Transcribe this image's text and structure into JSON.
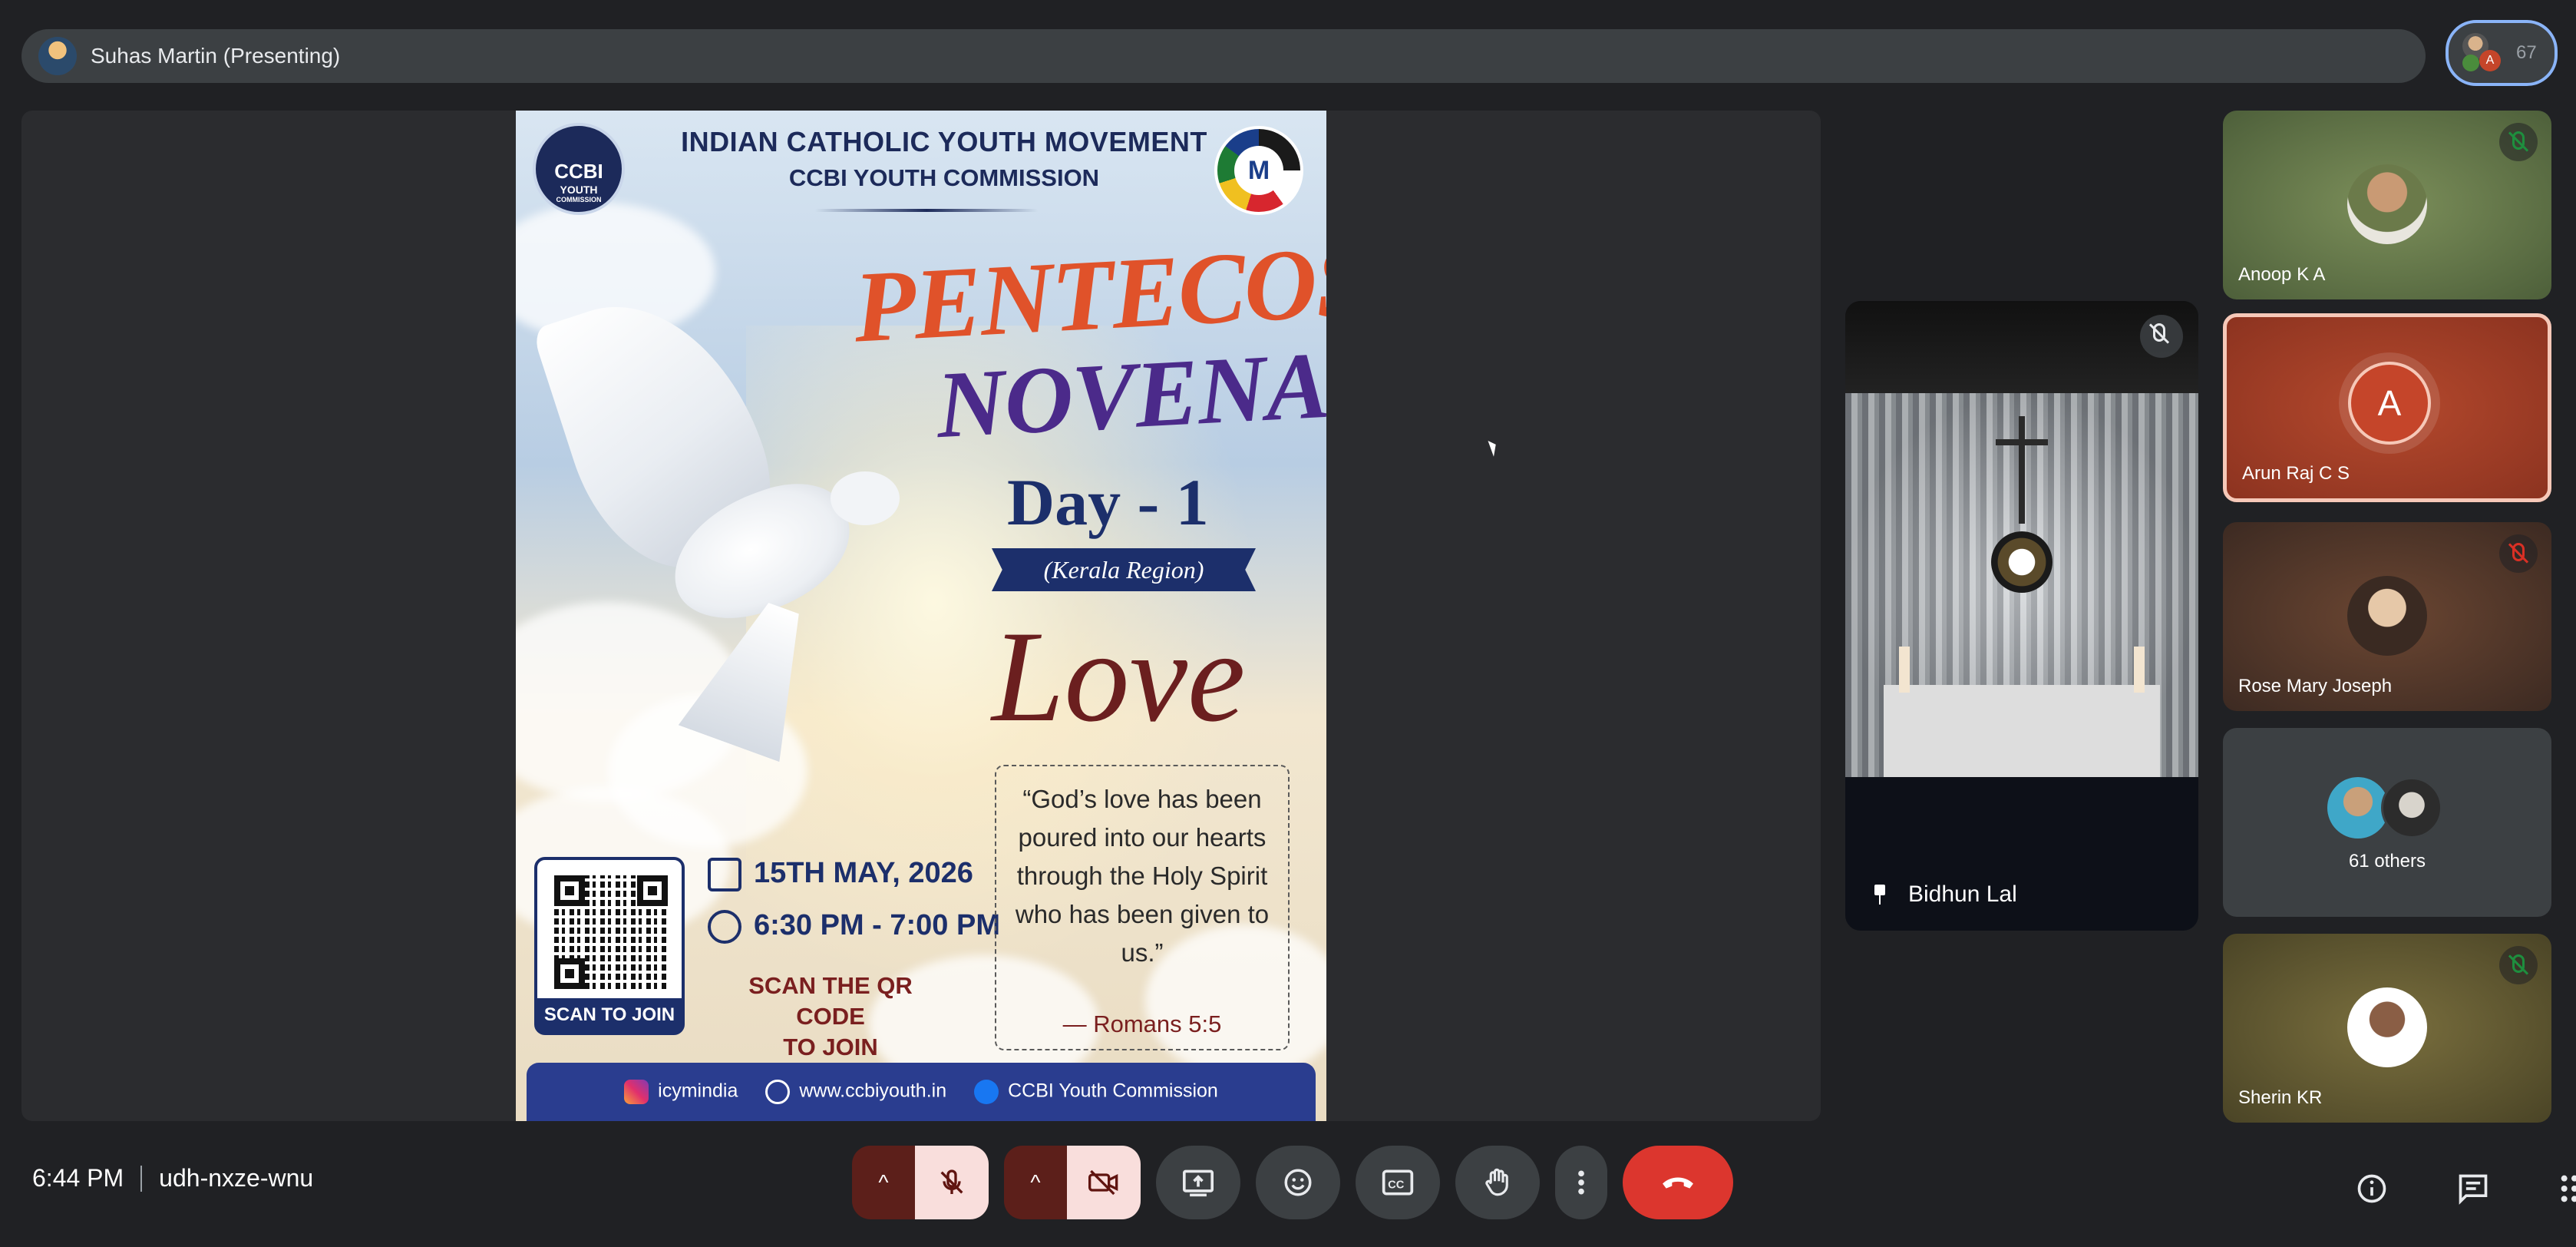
{
  "presenter": {
    "name": "Suhas Martin (Presenting)"
  },
  "participants": {
    "count": "67"
  },
  "poster": {
    "org_line1": "INDIAN CATHOLIC YOUTH MOVEMENT",
    "org_line2": "CCBI YOUTH COMMISSION",
    "logo_left_line1": "CCBI",
    "logo_left_line2": "YOUTH",
    "logo_left_line3": "COMMISSION",
    "logo_right_letter": "M",
    "title_line1": "PENTECOST",
    "title_line2": "NOVENA",
    "day": "Day - 1",
    "region": "(Kerala Region)",
    "theme": "Love",
    "qr_label": "SCAN TO JOIN",
    "date": "15TH MAY, 2026",
    "time": "6:30 PM - 7:00 PM",
    "scan_line1": "SCAN THE QR CODE",
    "scan_line2": "TO JOIN",
    "quote": "“God’s love has been poured into our hearts through the Holy Spirit who has been given to us.”",
    "quote_ref": "— Romans 5:5",
    "footer_instagram": "icymindia",
    "footer_web": "www.ccbiyouth.in",
    "footer_facebook": "CCBI Youth Commission"
  },
  "pinned": {
    "name": "Bidhun Lal"
  },
  "tiles": [
    {
      "name": "Anoop K A"
    },
    {
      "name": "Arun Raj C S",
      "initial": "A"
    },
    {
      "name": "Rose Mary Joseph"
    },
    {
      "others": "61 others"
    },
    {
      "name": "Sherin KR"
    }
  ],
  "meeting": {
    "time": "6:44 PM",
    "code": "udh-nxze-wnu"
  },
  "controls": {
    "caret": "^",
    "mic_icon": "mic-off-icon",
    "camera_icon": "camera-off-icon",
    "present_icon": "present-screen-icon",
    "emoji_icon": "emoji-icon",
    "captions_icon": "captions-icon",
    "hand_icon": "raise-hand-icon",
    "more_icon": "more-vert-icon",
    "hangup_icon": "hang-up-icon"
  },
  "colors": {
    "hangup": "#dc362e",
    "background": "#202124",
    "active_tile_border": "#f6c8b8",
    "pill_border": "#8ab4f8"
  }
}
